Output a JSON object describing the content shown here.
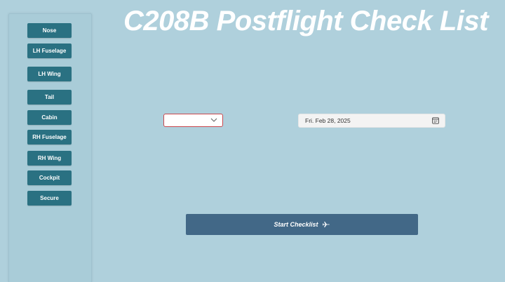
{
  "title": "C208B Postflight Check List",
  "sidebar": {
    "items": [
      {
        "label": "Nose"
      },
      {
        "label": "LH Fuselage"
      },
      {
        "label": "LH Wing"
      },
      {
        "label": "Tail"
      },
      {
        "label": "Cabin"
      },
      {
        "label": "RH Fuselage"
      },
      {
        "label": "RH Wing"
      },
      {
        "label": "Cockpit"
      },
      {
        "label": "Secure"
      }
    ]
  },
  "form": {
    "dropdown": {
      "value": "",
      "icon": "chevron-down-icon"
    },
    "date": {
      "value": "Fri. Feb 28, 2025",
      "icon": "calendar-icon"
    }
  },
  "start_button": {
    "label": "Start Checklist",
    "icon": "airplane-icon"
  },
  "colors": {
    "background": "#afd0dc",
    "nav_button": "#2a7182",
    "start_button": "#426887",
    "dropdown_border": "#c9484e"
  }
}
